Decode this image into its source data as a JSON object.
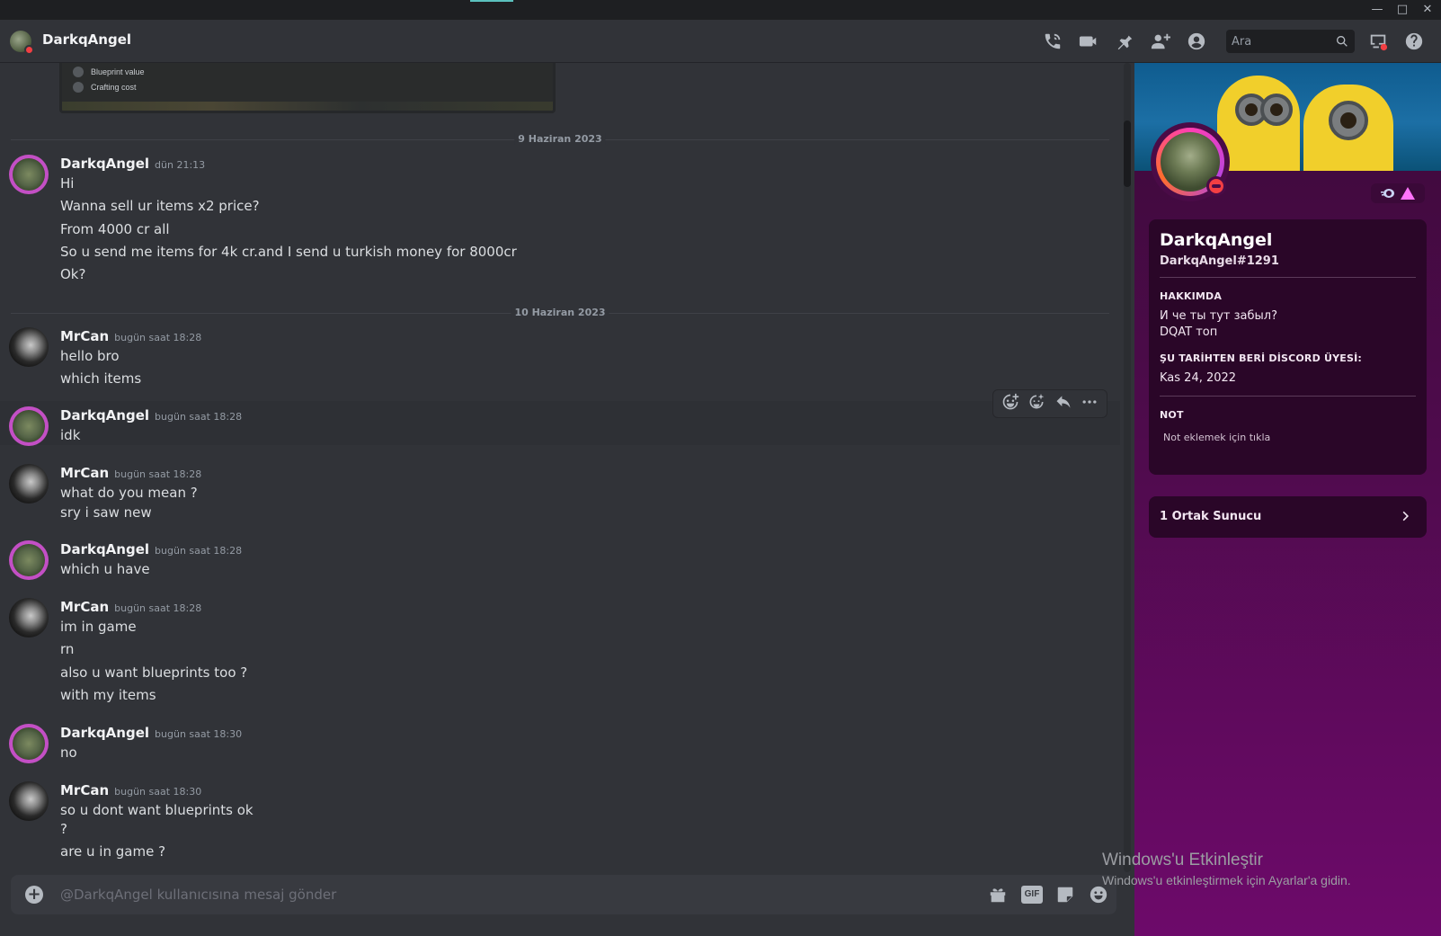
{
  "header": {
    "title": "DarkqAngel",
    "search_placeholder": "Ara",
    "icons": [
      "phone-call-icon",
      "video-camera-icon",
      "pin-icon",
      "add-friend-icon",
      "profile-toggle-icon",
      "search-icon",
      "inbox-icon",
      "help-icon"
    ]
  },
  "embed": {
    "rows": [
      "Blueprint value",
      "Crafting cost"
    ]
  },
  "dividers": [
    "9 Haziran 2023",
    "10 Haziran 2023"
  ],
  "messages": [
    {
      "user": "DarkqAngel",
      "time": "dün 21:13",
      "lines": [
        "Hi",
        "Wanna sell ur items x2 price?",
        "From 4000 cr all",
        "So u send me items for 4k cr.and I send u turkish money for 8000cr",
        "Ok?"
      ]
    },
    {
      "user": "MrCan",
      "time": "bugün saat 18:28",
      "lines": [
        "hello bro",
        "which items"
      ]
    },
    {
      "user": "DarkqAngel",
      "time": "bugün saat 18:28",
      "lines": [
        "idk"
      ]
    },
    {
      "user": "MrCan",
      "time": "bugün saat 18:28",
      "lines": [
        "what do you mean ?",
        "sry i saw new"
      ]
    },
    {
      "user": "DarkqAngel",
      "time": "bugün saat 18:28",
      "lines": [
        "which u have"
      ]
    },
    {
      "user": "MrCan",
      "time": "bugün saat 18:28",
      "lines": [
        "im in game",
        "rn",
        "also u want blueprints too ?",
        "with my items"
      ]
    },
    {
      "user": "DarkqAngel",
      "time": "bugün saat 18:30",
      "lines": [
        "no"
      ]
    },
    {
      "user": "MrCan",
      "time": "bugün saat 18:30",
      "lines": [
        "so u dont want blueprints ok",
        "?",
        "are u in game ?"
      ]
    }
  ],
  "composer": {
    "placeholder": "@DarkqAngel kullanıcısına mesaj gönder",
    "gif_label": "GIF"
  },
  "profile": {
    "display_name": "DarkqAngel",
    "tag": "DarkqAngel#1291",
    "about_heading": "HAKKIMDA",
    "about_lines": [
      "И че ты тут забыл?",
      "DQAT топ"
    ],
    "member_since_heading": "ŞU TARİHTEN BERİ DİSCORD ÜYESİ:",
    "member_since": "Kas 24, 2022",
    "note_heading": "NOT",
    "note_placeholder": "Not eklemek için tıkla",
    "mutual_servers": "1 Ortak Sunucu"
  },
  "watermark": {
    "line1": "Windows'u Etkinleştir",
    "line2": "Windows'u etkinleştirmek için Ayarlar'a gidin."
  },
  "colors": {
    "background": "#313338",
    "profile_gradient_top": "#3d0a3a",
    "profile_gradient_bottom": "#6d0a6a",
    "dnd_status": "#f23f43"
  }
}
